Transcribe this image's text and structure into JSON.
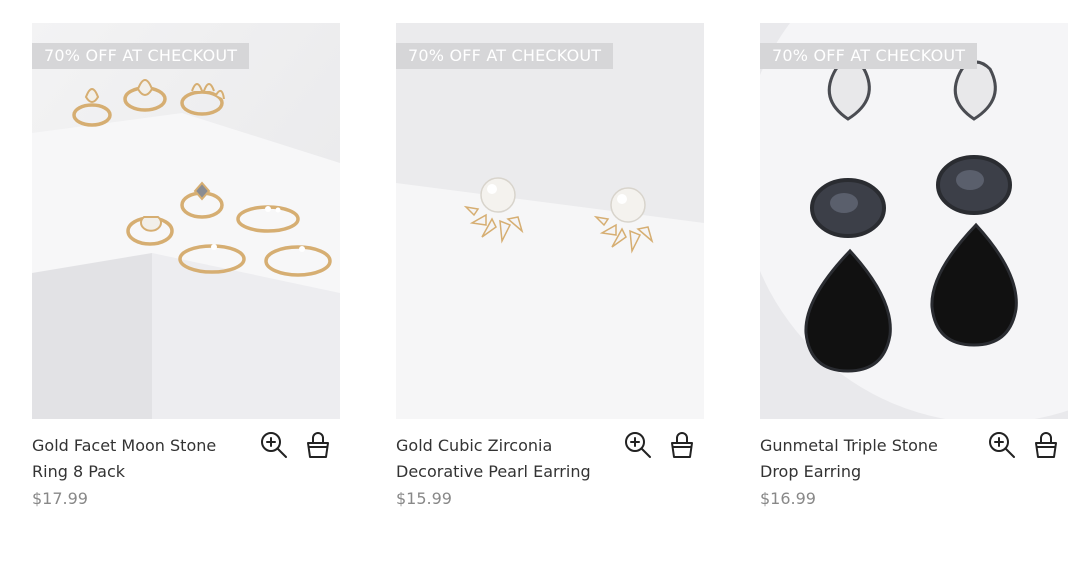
{
  "products": [
    {
      "badge": "70% OFF AT CHECKOUT",
      "name": "Gold Facet Moon Stone Ring 8 Pack",
      "price": "$17.99",
      "image": "gold-rings-set"
    },
    {
      "badge": "70% OFF AT CHECKOUT",
      "name": "Gold Cubic Zirconia Decorative Pearl Earring",
      "price": "$15.99",
      "image": "pearl-earrings"
    },
    {
      "badge": "70% OFF AT CHECKOUT",
      "name": "Gunmetal Triple Stone Drop Earring",
      "price": "$16.99",
      "image": "black-drop-earrings"
    }
  ],
  "icons": {
    "quick_view": "zoom-in-icon",
    "add_to_bag": "shopping-bag-icon"
  },
  "colors": {
    "badge_bg": "#d6d6d8",
    "badge_text": "#ffffff",
    "name_text": "#333333",
    "price_text": "#888888",
    "gold": "#d9b27a",
    "gunmetal": "#3a3c42"
  }
}
